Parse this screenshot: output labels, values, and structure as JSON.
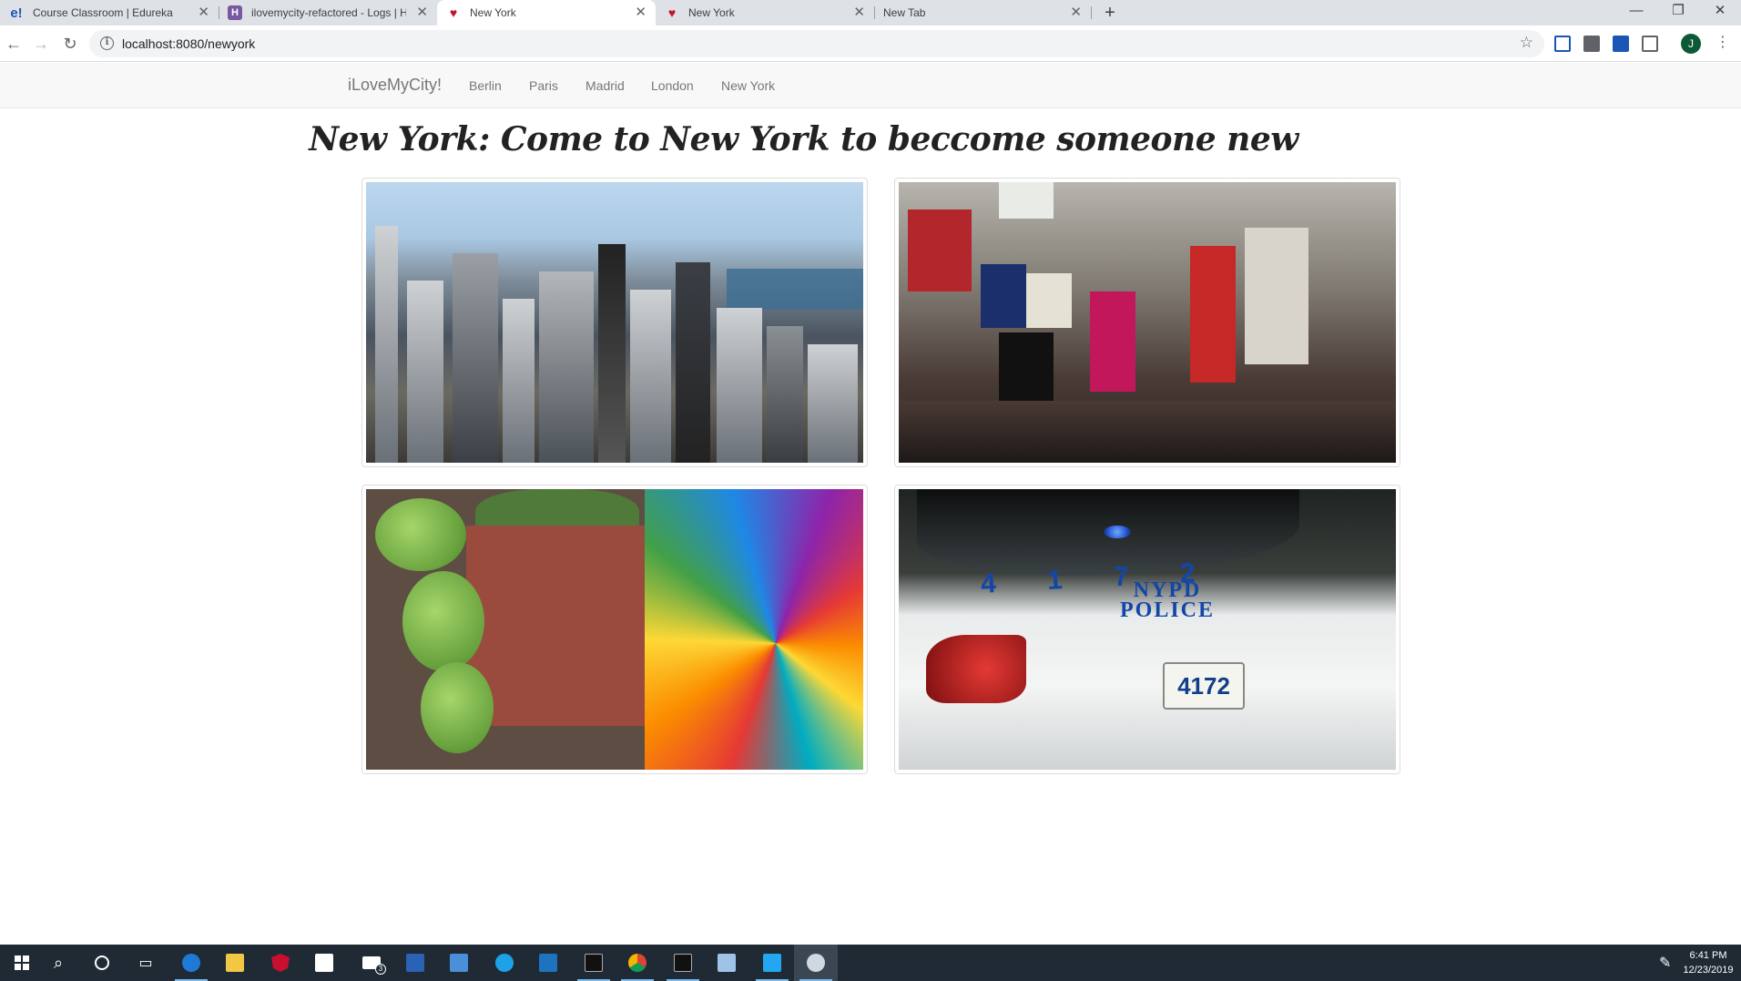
{
  "browser": {
    "tabs": [
      {
        "title": "Course Classroom | Edureka",
        "favicon": "edureka-icon",
        "active": false
      },
      {
        "title": "ilovemycity-refactored - Logs | He",
        "favicon": "heroku-icon",
        "active": false
      },
      {
        "title": "New York",
        "favicon": "heart-icon",
        "active": true
      },
      {
        "title": "New York",
        "favicon": "heart-icon",
        "active": false
      },
      {
        "title": "New Tab",
        "favicon": "",
        "active": false
      }
    ],
    "new_tab_symbol": "+",
    "url": "localhost:8080/newyork",
    "avatar_letter": "J"
  },
  "site": {
    "brand": "iLoveMyCity!",
    "nav": [
      "Berlin",
      "Paris",
      "Madrid",
      "London",
      "New York"
    ]
  },
  "page": {
    "heading": "New York: Come to New York to beccome someone new",
    "images": [
      {
        "subject": "skyline-photo"
      },
      {
        "subject": "times-square-photo"
      },
      {
        "subject": "street-mural-photo"
      },
      {
        "subject": "nypd-police-car-photo",
        "car_number": "4 1 7 2",
        "car_text_line1": "NYPD",
        "car_text_line2": "POLICE",
        "plate": "4172"
      }
    ]
  },
  "taskbar": {
    "time": "6:41 PM",
    "date": "12/23/2019",
    "mail_badge": "3"
  }
}
